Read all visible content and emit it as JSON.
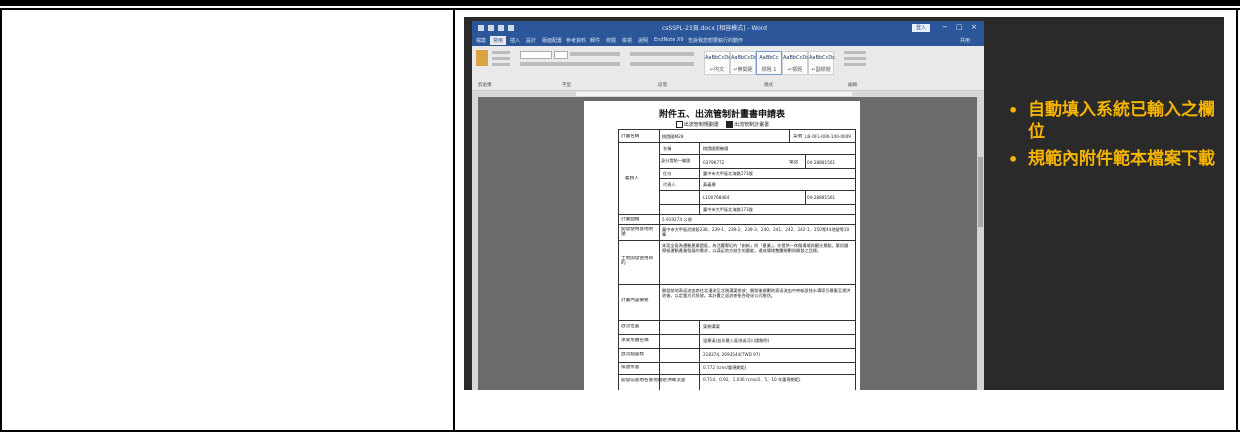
{
  "word": {
    "title": "csSSPL-23頁.docx [相容模式] - Word",
    "account_badge": "登入",
    "window_controls": [
      "−",
      "□",
      "×"
    ],
    "tabs": [
      "檔案",
      "常用",
      "插入",
      "設計",
      "版面配置",
      "參考資料",
      "郵件",
      "校閱",
      "檢視",
      "說明",
      "EndNote X9",
      "告訴我您想要執行的動作"
    ],
    "share_label": "共用",
    "ribbon_groups": [
      "剪貼簿",
      "字型",
      "段落",
      "樣式",
      "編輯"
    ],
    "styles": [
      {
        "sample": "AaBbCcDc",
        "name": "↵內文"
      },
      {
        "sample": "AaBbCcDc",
        "name": "↵無間距"
      },
      {
        "sample": "AaBbCc",
        "name": "標題 1"
      },
      {
        "sample": "AaBbCcDc",
        "name": "↵標題"
      },
      {
        "sample": "AaBbCcDc",
        "name": "↵副標題"
      }
    ]
  },
  "document": {
    "title": "附件五、出流管制計畫書申請表",
    "check_a": "出流管制規劃書",
    "check_b": "出流管制計畫書",
    "rows": {
      "plan_name_label": "計畫名稱",
      "plan_name_value": "桃園國M28",
      "doc_no_label": "案號",
      "doc_no_value": "LB-OFL-000-100-0049",
      "applicant_label": "義務人",
      "name_label": "名稱",
      "name_value": "桃園國際機場",
      "id_label": "身分證統一編號",
      "id_value": "03796772",
      "tel_label": "電話",
      "tel_value": "04-28881561",
      "addr_label": "住址",
      "addr_value": "臺中市大甲區北海路173號",
      "rep_label": "代表人",
      "rep_value": "黃義傳",
      "rep_id_value": "L100768464",
      "rep_tel_value": "04-28881561",
      "rep_addr_value": "臺中市大甲區北海路173號",
      "area_label": "計畫面積",
      "area_value": "5.919274 公頃",
      "location_label": "開發使用基地地號",
      "location_value": "臺中市大甲區武陵段238、239-1、239-2、239-3、240、241、242、242-1、250等44地號等10筆",
      "purpose_label": "土地開發使用目的",
      "purpose_text": "本案全區為運動產業園區，為活躍鄰近的「創新」與「產業」，亦提供一休閒場域與觀光景點，緊扣國際級運動產業發展的需求，以滿足地方創生的量能，達成場域整體規劃與開發之目標。",
      "content_label": "計畫內容摘要",
      "content_text": "開發前地表逕流由南往北漫流至北側溝渠排放；開發後規劃地表逕流由中央新設排水溝導引匯集至滯洪池後，以定量方式排放。本計畫之逕流係依合理化公式推估。",
      "outfall_label": "放流位置",
      "outfall_value": "東側溝渠",
      "receiving_label": "承受水體名稱",
      "receiving_value": "溫寮溪(若非匯入區排或河川請敘明)",
      "coord_label": "放流點座標",
      "coord_value": "218374, 2693544(TWD 97)",
      "q_label": "排放水量",
      "q_value": "0.772 (cms/重現期距)",
      "peak_label": "開發前基地各重現期距洪峰流量",
      "peak_value": "0.714、0.92、1.036 (cms/2、5、10 年重現期距)"
    }
  },
  "bullets": [
    {
      "text": "自動填入系統已輸入之欄位"
    },
    {
      "text": "規範內附件範本檔案下載"
    }
  ]
}
